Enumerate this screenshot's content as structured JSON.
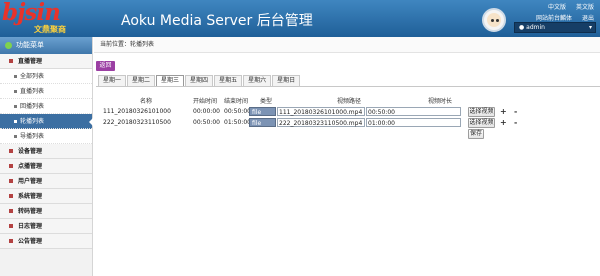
{
  "header": {
    "logo_text": "bjsin",
    "logo_sub": "文鼎聚商",
    "app_title": "Aoku Media Server 后台管理",
    "links_row1": [
      "中文版",
      "英文版"
    ],
    "links_row2": [
      "网站前台麟体",
      "退出"
    ],
    "user": "admin"
  },
  "sidebar": {
    "title": "功能菜单",
    "group_live": "直播管理",
    "items": [
      {
        "label": "全部列表"
      },
      {
        "label": "直播列表"
      },
      {
        "label": "回播列表"
      },
      {
        "label": "轮播列表"
      },
      {
        "label": "导播列表"
      }
    ],
    "groups": [
      {
        "label": "设备管理"
      },
      {
        "label": "点播管理"
      },
      {
        "label": "用户管理"
      },
      {
        "label": "系统管理"
      },
      {
        "label": "转码管理"
      },
      {
        "label": "日志管理"
      },
      {
        "label": "公告管理"
      }
    ]
  },
  "main": {
    "breadcrumb": "当前位置：轮播列表",
    "back": "返回",
    "tabs": [
      "星期一",
      "星期二",
      "星期三",
      "星期四",
      "星期五",
      "星期六",
      "星期日"
    ],
    "active_tab": "星期三",
    "columns": {
      "name": "名称",
      "start": "开始时间",
      "end": "结束时间",
      "type": "类型",
      "path": "视频路径",
      "duration": "视频时长"
    },
    "rows": [
      {
        "name": "111_20180326101000",
        "start": "00:00:00",
        "end": "00:50:00",
        "type": "file",
        "path": "111_20180326101000.mp4",
        "duration": "00:50:00"
      },
      {
        "name": "222_20180323110500",
        "start": "00:50:00",
        "end": "01:50:00",
        "type": "file",
        "path": "222_20180323110500.mp4",
        "duration": "01:00:00"
      }
    ],
    "select_video": "选择视频",
    "plus": "+",
    "minus": "-",
    "save": "保存"
  }
}
